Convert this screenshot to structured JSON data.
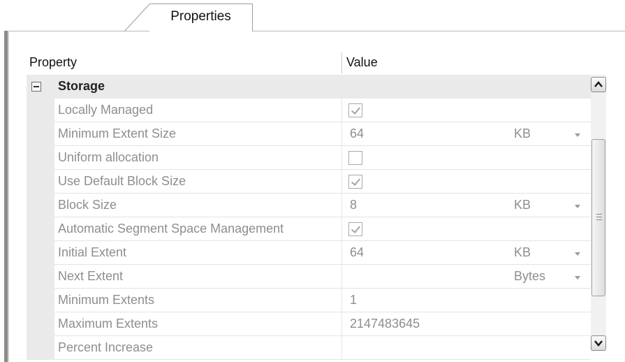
{
  "tabs": [
    {
      "label": "Properties",
      "active": true
    }
  ],
  "grid": {
    "columns": {
      "property": "Property",
      "value": "Value"
    },
    "group": {
      "label": "Storage",
      "expanded": true
    },
    "rows": [
      {
        "name": "Locally Managed",
        "type": "checkbox",
        "checked": true
      },
      {
        "name": "Minimum Extent Size",
        "type": "dropdown",
        "value": "64",
        "unit": "KB"
      },
      {
        "name": "Uniform allocation",
        "type": "checkbox",
        "checked": false
      },
      {
        "name": "Use Default Block Size",
        "type": "checkbox",
        "checked": true
      },
      {
        "name": "Block Size",
        "type": "dropdown",
        "value": "8",
        "unit": "KB"
      },
      {
        "name": "Automatic Segment Space Management",
        "type": "checkbox",
        "checked": true
      },
      {
        "name": "Initial Extent",
        "type": "dropdown",
        "value": "64",
        "unit": "KB"
      },
      {
        "name": "Next Extent",
        "type": "dropdown",
        "value": "",
        "unit": "Bytes"
      },
      {
        "name": "Minimum Extents",
        "type": "text",
        "value": "1"
      },
      {
        "name": "Maximum Extents",
        "type": "text",
        "value": "2147483645"
      },
      {
        "name": "Percent Increase",
        "type": "text",
        "value": ""
      }
    ]
  },
  "scrollbar": {
    "up_icon": "chevron-up-icon",
    "down_icon": "chevron-down-icon"
  },
  "colors": {
    "group_background": "#eaeaea",
    "disabled_text": "#8e8e8e"
  }
}
